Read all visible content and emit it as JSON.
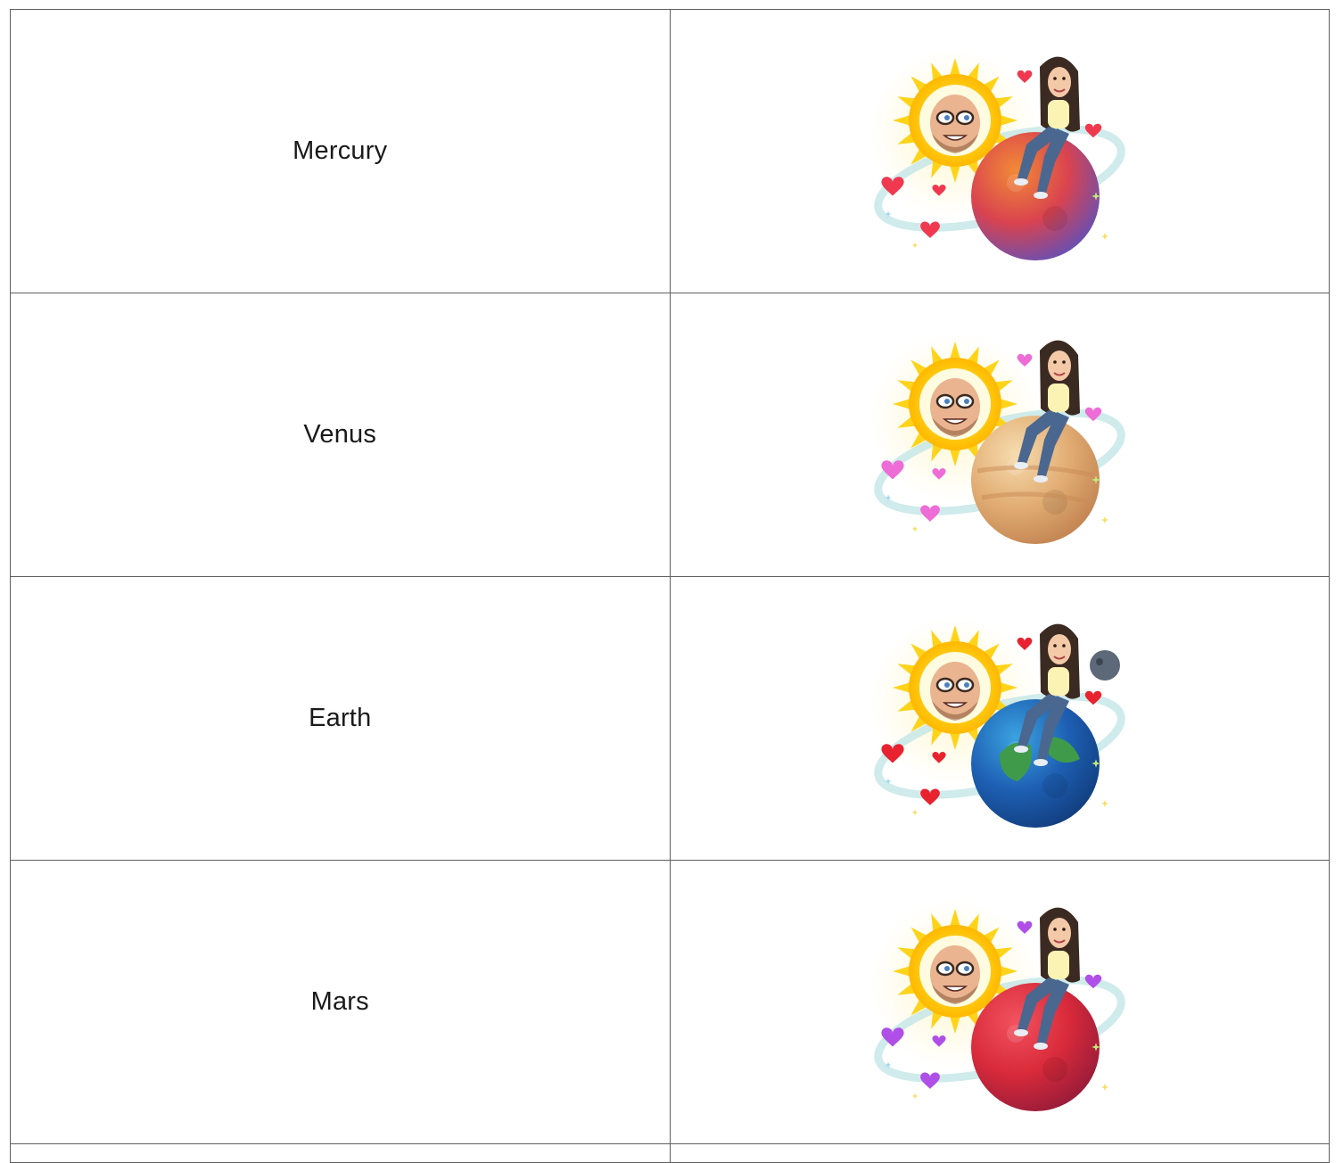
{
  "rows": [
    {
      "name": "Mercury",
      "sticker": {
        "icon": "bitmoji-friendship-planet-mercury",
        "planet_colors": [
          "#f28a36",
          "#d9434f",
          "#6a4fb0"
        ],
        "heart_color": "#f0394f"
      }
    },
    {
      "name": "Venus",
      "sticker": {
        "icon": "bitmoji-friendship-planet-venus",
        "planet_colors": [
          "#f6dcae",
          "#e2ad74",
          "#c38552"
        ],
        "heart_color": "#ee6cd6"
      }
    },
    {
      "name": "Earth",
      "sticker": {
        "icon": "bitmoji-friendship-planet-earth",
        "planet_colors": [
          "#3aa3e0",
          "#1e5fb3",
          "#123f80"
        ],
        "heart_color": "#e8222f"
      }
    },
    {
      "name": "Mars",
      "sticker": {
        "icon": "bitmoji-friendship-planet-mars",
        "planet_colors": [
          "#f2525e",
          "#d82a3a",
          "#9a1c3a"
        ],
        "heart_color": "#b04ee8"
      }
    }
  ],
  "palette": {
    "sun_outer": "#ffd319",
    "sun_inner": "#fff3b0",
    "orbit": "#bfe4e6",
    "hair": "#3b2a22",
    "skin_him": "#e9b48f",
    "skin_her": "#f3c9a8",
    "shirt": "#fbf3b4",
    "jeans": "#4a6790"
  }
}
